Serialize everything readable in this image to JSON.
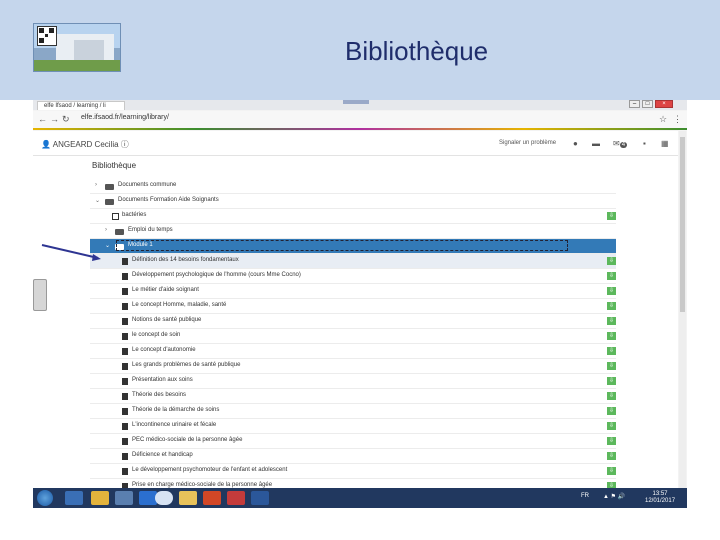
{
  "slide": {
    "title": "Bibliothèque"
  },
  "browser": {
    "tab_label": "elfe Ifsaod / learning / li",
    "url": "elfe.ifsaod.fr/learning/library/",
    "win_min": "–",
    "win_max": "□",
    "win_close": "×"
  },
  "app": {
    "user": "ANGEARD Cecilia",
    "report_link": "Signaler un problème",
    "badge_count": "4"
  },
  "library": {
    "title": "Bibliothèque",
    "rows": [
      {
        "label": "Documents commune",
        "type": "folder",
        "chev": "›",
        "indent": 0
      },
      {
        "label": "Documents Formation Aide Soignants",
        "type": "folder",
        "chev": "⌄",
        "indent": 0
      },
      {
        "label": "bactéries",
        "type": "grid",
        "indent": 1,
        "download": true
      },
      {
        "label": "Emploi du temps",
        "type": "folder",
        "chev": "›",
        "indent": 1
      },
      {
        "label": "Module 1",
        "type": "folder",
        "chev": "⌄",
        "indent": 1,
        "selected": true
      },
      {
        "label": "Définition des 14 besoins fondamentaux",
        "type": "doc",
        "indent": 2,
        "download": true,
        "highlight": true
      },
      {
        "label": "Développement psychologique de l'homme (cours Mme Cocno)",
        "type": "doc",
        "indent": 2,
        "download": true
      },
      {
        "label": "Le métier d'aide soignant",
        "type": "doc",
        "indent": 2,
        "download": true
      },
      {
        "label": "Le concept Homme, maladie, santé",
        "type": "doc",
        "indent": 2,
        "download": true
      },
      {
        "label": "Notions de santé publique",
        "type": "doc",
        "indent": 2,
        "download": true
      },
      {
        "label": "le concept de soin",
        "type": "doc",
        "indent": 2,
        "download": true
      },
      {
        "label": "Le concept d'autonomie",
        "type": "doc",
        "indent": 2,
        "download": true
      },
      {
        "label": "Les grands problèmes de santé publique",
        "type": "doc",
        "indent": 2,
        "download": true
      },
      {
        "label": "Présentation aux soins",
        "type": "doc",
        "indent": 2,
        "download": true
      },
      {
        "label": "Théorie des besoins",
        "type": "doc",
        "indent": 2,
        "download": true
      },
      {
        "label": "Théorie de la démarche de soins",
        "type": "doc",
        "indent": 2,
        "download": true
      },
      {
        "label": "L'incontinence urinaire et fécale",
        "type": "doc",
        "indent": 2,
        "download": true
      },
      {
        "label": "PEC médico-sociale de la personne âgée",
        "type": "doc",
        "indent": 2,
        "download": true
      },
      {
        "label": "Déficience et handicap",
        "type": "doc",
        "indent": 2,
        "download": true
      },
      {
        "label": "Le développement psychomoteur de l'enfant et adolescent",
        "type": "doc",
        "indent": 2,
        "download": true
      },
      {
        "label": "Prise en charge médico-sociale de la personne âgée",
        "type": "doc",
        "indent": 2,
        "download": true
      }
    ]
  },
  "taskbar": {
    "lang": "FR",
    "time": "13:57",
    "date": "12/01/2017"
  },
  "colors": {
    "banner": "#c5d6ec",
    "title": "#1f2d6b",
    "selected": "#337ab7",
    "download": "#5cb85c"
  }
}
